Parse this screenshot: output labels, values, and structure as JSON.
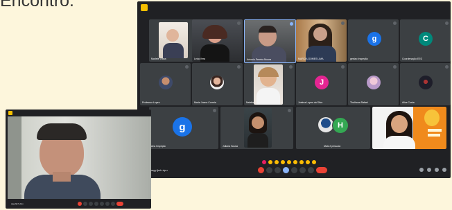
{
  "heading": "Encontro.",
  "main_window": {
    "meeting_code": "aqg-fjmh-dpu",
    "tiles": [
      {
        "name": "Marlete Viana"
      },
      {
        "name": "Leda Vera"
      },
      {
        "name": "Antonio Pereira Moura"
      },
      {
        "name": "MARCIA GOMES LIMA"
      },
      {
        "name": "gestao Inspeção",
        "letter": "g",
        "color": "#1a73e8"
      },
      {
        "name": "Coordenação EEG",
        "letter": "C",
        "color": "#00897b"
      },
      {
        "name": "Professor Lopes"
      },
      {
        "name": "Maria Joana Correia"
      },
      {
        "name": "Natalia"
      },
      {
        "name": "Joelma Lopes da Silva",
        "letter": "J",
        "color": "#e52592"
      },
      {
        "name": "Thalhana Rafael"
      },
      {
        "name": "Alice Costa"
      },
      {
        "name": "Ana Inspeção",
        "letter": "g",
        "color": "#1a73e8"
      },
      {
        "name": "Juliana Sousa"
      },
      {
        "name": "Mais 2 pessoas",
        "letter": "H",
        "color": "#34a853"
      },
      {
        "name": ""
      }
    ],
    "control_icons": [
      "mic-icon",
      "camera-icon",
      "captions-icon",
      "emoji-icon",
      "present-icon",
      "hand-icon",
      "more-icon",
      "hangup-icon"
    ],
    "right_icons": [
      "info-icon",
      "people-icon",
      "chat-icon",
      "activities-icon"
    ]
  },
  "small_window": {
    "meeting_code": "aqg-fjmh-dpu"
  }
}
